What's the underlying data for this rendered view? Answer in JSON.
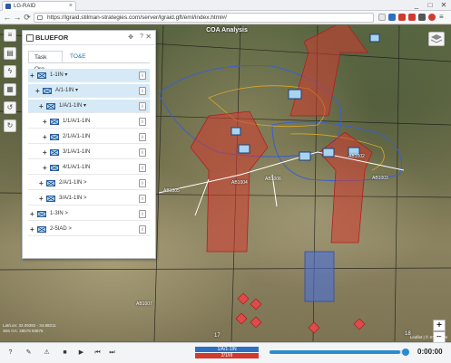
{
  "browser": {
    "tab_title": "LG-RAID",
    "url": "https://lgraid.stilman-strategies.com/server/lgraid.gft/eml/index.html#/",
    "window_controls": [
      "_",
      "□",
      "✕"
    ],
    "nav": {
      "back": "←",
      "forward": "→",
      "reload": "⟳"
    }
  },
  "map": {
    "title": "COA Analysis",
    "coords_text_1": "Lat/Lon: 32.09392 - 34.88211",
    "coords_text_2": "36S GA: 28579 93876",
    "attribution": "Leaflet | © STILMAN",
    "grid_label_17": "17",
    "grid_label_18": "18",
    "zoom_in": "+",
    "zoom_out": "−"
  },
  "left_toolbar": {
    "buttons": [
      "menu-icon",
      "document-icon",
      "bolt-icon",
      "grid-icon",
      "undo-icon",
      "redo-icon"
    ]
  },
  "panel": {
    "title": "BLUEFOR",
    "help": "?",
    "pin": "✥",
    "close": "✕",
    "tabs": [
      {
        "label": "Task Org"
      },
      {
        "label": "TO&E"
      }
    ],
    "rows": [
      {
        "label": "1-1IN ▾",
        "expander": "+",
        "info": "i",
        "highlighted": true
      },
      {
        "label": "A/1-1IN ▾",
        "expander": "+",
        "info": "i",
        "highlighted": true
      },
      {
        "label": "1/A/1-1IN ▾",
        "expander": "+",
        "info": "i",
        "highlighted": true
      },
      {
        "label": "1/1/A/1-1IN",
        "expander": "+",
        "info": "i",
        "highlighted": false
      },
      {
        "label": "2/1/A/1-1IN",
        "expander": "+",
        "info": "i",
        "highlighted": false
      },
      {
        "label": "3/1/A/1-1IN",
        "expander": "+",
        "info": "i",
        "highlighted": false
      },
      {
        "label": "4/1/A/1-1IN",
        "expander": "+",
        "info": "i",
        "highlighted": false
      },
      {
        "label": "2/A/1-1IN >",
        "expander": "+",
        "info": "i",
        "highlighted": false
      },
      {
        "label": "3/A/1-1IN >",
        "expander": "+",
        "info": "i",
        "highlighted": false
      },
      {
        "label": "1-3IN >",
        "expander": "+",
        "info": "i",
        "highlighted": false
      },
      {
        "label": "2-5IAD >",
        "expander": "+",
        "info": "i",
        "highlighted": false
      }
    ]
  },
  "map_labels": [
    {
      "text": "AB1004"
    },
    {
      "text": "AB1006"
    },
    {
      "text": "AB1007"
    },
    {
      "text": "AB1005"
    },
    {
      "text": "AB1003"
    },
    {
      "text": "AB1002"
    }
  ],
  "bottom_bar": {
    "buttons": [
      "?",
      "✎",
      "⚠",
      "■",
      "▶",
      "⏮",
      "⏭"
    ],
    "side_blue_label": "1/A/1-1IN",
    "side_red_label": "2/1/III",
    "progress_fraction": 0.97,
    "timer": "0:00:00"
  },
  "colors": {
    "friendly_blue": "#2f6fc0",
    "enemy_red": "#d13a2f",
    "accent": "#2a8ccf"
  }
}
